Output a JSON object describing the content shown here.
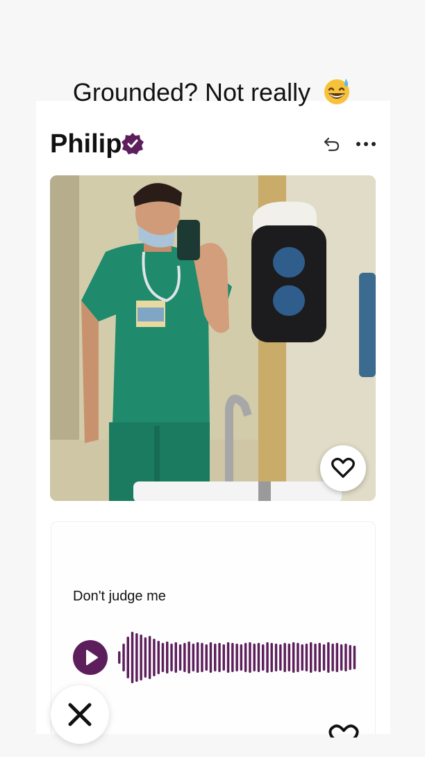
{
  "caption": {
    "text": "Grounded? Not really",
    "emoji": "grinning-sweat-emoji"
  },
  "profile": {
    "name": "Philip",
    "verified": true,
    "icons": {
      "verified": "verified-badge-icon",
      "undo": "undo-arrow-icon",
      "more": "more-options-icon"
    }
  },
  "photo": {
    "description_icon": "profile-photo",
    "like_icon": "heart-icon"
  },
  "voice_prompt": {
    "text": "Don't judge me",
    "play_icon": "play-icon",
    "waveform_icon": "waveform-icon"
  },
  "actions": {
    "dismiss_icon": "close-x-icon",
    "like_icon": "heart-icon"
  },
  "colors": {
    "accent": "#5d1f5c",
    "background": "#f7f7f7",
    "card": "#ffffff",
    "text": "#111111"
  }
}
